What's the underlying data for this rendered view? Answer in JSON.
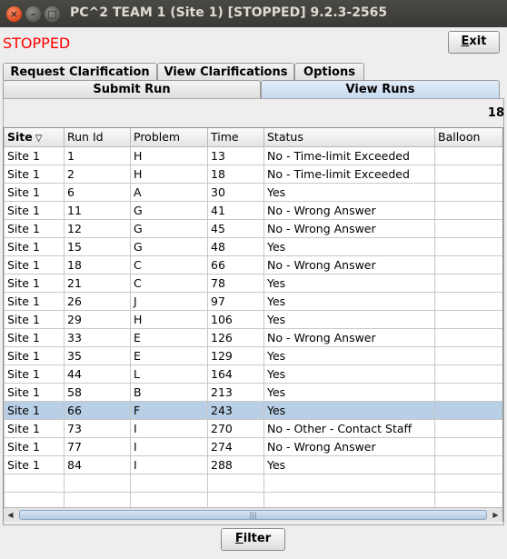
{
  "window": {
    "title": "PC^2 TEAM 1 (Site 1) [STOPPED] 9.2.3-2565",
    "close_glyph": "×",
    "min_glyph": "–",
    "max_glyph": "□"
  },
  "status_label": "STOPPED",
  "exit_button": {
    "mnemonic": "E",
    "rest": "xit"
  },
  "tabs_top": [
    "Request Clarification",
    "View Clarifications",
    "Options"
  ],
  "tabs_bottom": [
    "Submit Run",
    "View Runs"
  ],
  "selected_tab": "View Runs",
  "run_count": "18",
  "table": {
    "columns": [
      "Site",
      "Run Id",
      "Problem",
      "Time",
      "Status",
      "Balloon"
    ],
    "sort_column": "Site",
    "sort_icon": "▽",
    "rows": [
      [
        "Site 1",
        "1",
        "H",
        "13",
        "No - Time-limit Exceeded",
        ""
      ],
      [
        "Site 1",
        "2",
        "H",
        "18",
        "No - Time-limit Exceeded",
        ""
      ],
      [
        "Site 1",
        "6",
        "A",
        "30",
        "Yes",
        ""
      ],
      [
        "Site 1",
        "11",
        "G",
        "41",
        "No - Wrong Answer",
        ""
      ],
      [
        "Site 1",
        "12",
        "G",
        "45",
        "No - Wrong Answer",
        ""
      ],
      [
        "Site 1",
        "15",
        "G",
        "48",
        "Yes",
        ""
      ],
      [
        "Site 1",
        "18",
        "C",
        "66",
        "No - Wrong Answer",
        ""
      ],
      [
        "Site 1",
        "21",
        "C",
        "78",
        "Yes",
        ""
      ],
      [
        "Site 1",
        "26",
        "J",
        "97",
        "Yes",
        ""
      ],
      [
        "Site 1",
        "29",
        "H",
        "106",
        "Yes",
        ""
      ],
      [
        "Site 1",
        "33",
        "E",
        "126",
        "No - Wrong Answer",
        ""
      ],
      [
        "Site 1",
        "35",
        "E",
        "129",
        "Yes",
        ""
      ],
      [
        "Site 1",
        "44",
        "L",
        "164",
        "Yes",
        ""
      ],
      [
        "Site 1",
        "58",
        "B",
        "213",
        "Yes",
        ""
      ],
      [
        "Site 1",
        "66",
        "F",
        "243",
        "Yes",
        ""
      ],
      [
        "Site 1",
        "73",
        "I",
        "270",
        "No - Other - Contact Staff",
        ""
      ],
      [
        "Site 1",
        "77",
        "I",
        "274",
        "No - Wrong Answer",
        ""
      ],
      [
        "Site 1",
        "84",
        "I",
        "288",
        "Yes",
        ""
      ]
    ],
    "selected_row_index": 14
  },
  "scrollbar": {
    "left_glyph": "◀",
    "right_glyph": "▶",
    "grip": "|||"
  },
  "filter_button": {
    "mnemonic": "F",
    "rest": "ilter"
  },
  "colors": {
    "status_stopped": "#ff0000",
    "selected_row": "#b8cfe5",
    "selected_tab": "#c6d9ee"
  }
}
